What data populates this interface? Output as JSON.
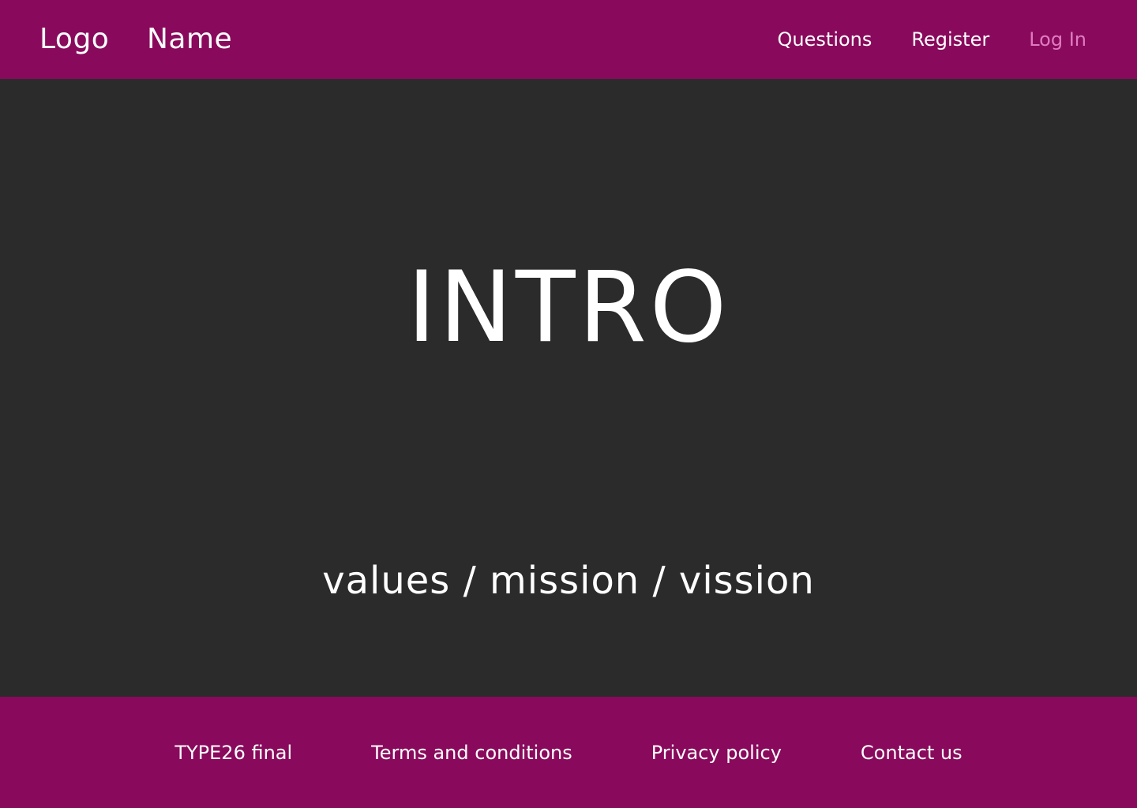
{
  "header": {
    "logo": "Logo",
    "name": "Name",
    "nav": [
      {
        "label": "Questions"
      },
      {
        "label": "Register"
      },
      {
        "label": "Log In"
      }
    ]
  },
  "hero": {
    "title": "INTRO",
    "subtitle": "values / mission / vission"
  },
  "footer": {
    "brand": "TYPE26 final",
    "links": [
      {
        "label": "Terms and conditions"
      },
      {
        "label": "Privacy policy"
      },
      {
        "label": "Contact us"
      }
    ]
  },
  "colors": {
    "brand": "#890a5c",
    "background": "#2b2b2b",
    "active_nav": "#e07bc0",
    "text": "#ffffff"
  }
}
